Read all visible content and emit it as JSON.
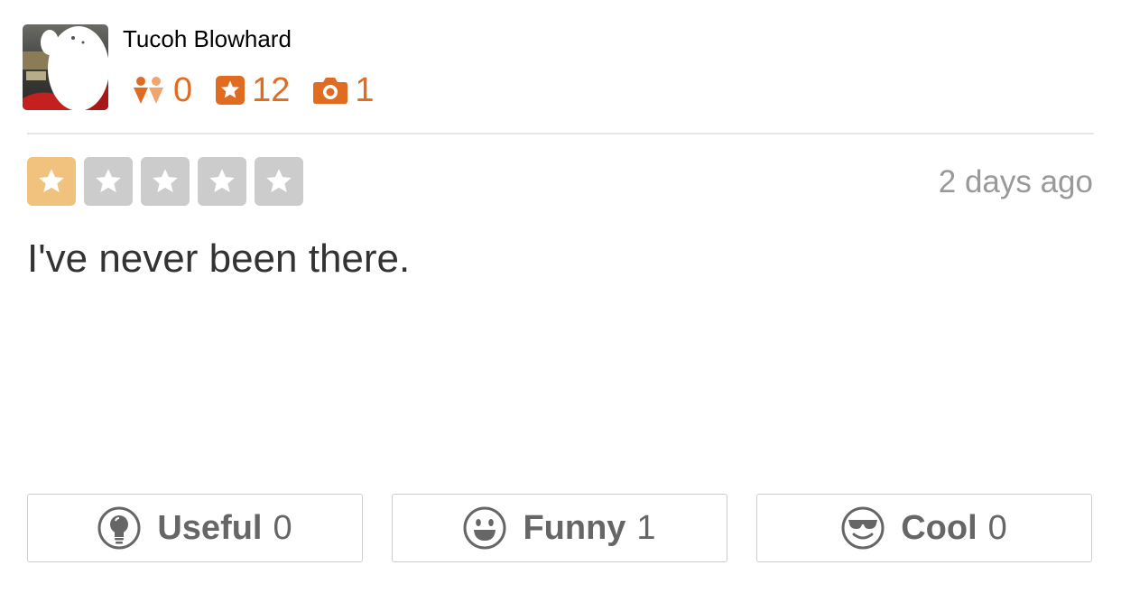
{
  "user": {
    "name": "Tucoh Blowhard",
    "friends_count": "0",
    "reviews_count": "12",
    "photos_count": "1"
  },
  "review": {
    "rating": 1,
    "rating_max": 5,
    "date": "2 days ago",
    "text": "I've never been there."
  },
  "votes": {
    "useful_label": "Useful",
    "useful_count": "0",
    "funny_label": "Funny",
    "funny_count": "1",
    "cool_label": "Cool",
    "cool_count": "0"
  },
  "icons": {
    "friends": "friends-icon",
    "reviews": "star-badge-icon",
    "photos": "camera-icon",
    "useful": "lightbulb-icon",
    "funny": "smiley-icon",
    "cool": "sunglasses-smiley-icon"
  },
  "colors": {
    "stat_orange": "#e06c22",
    "star_filled": "#f0c27d",
    "star_empty": "#cccccc",
    "divider": "#e6e6e6",
    "vote_gray": "#666666"
  }
}
